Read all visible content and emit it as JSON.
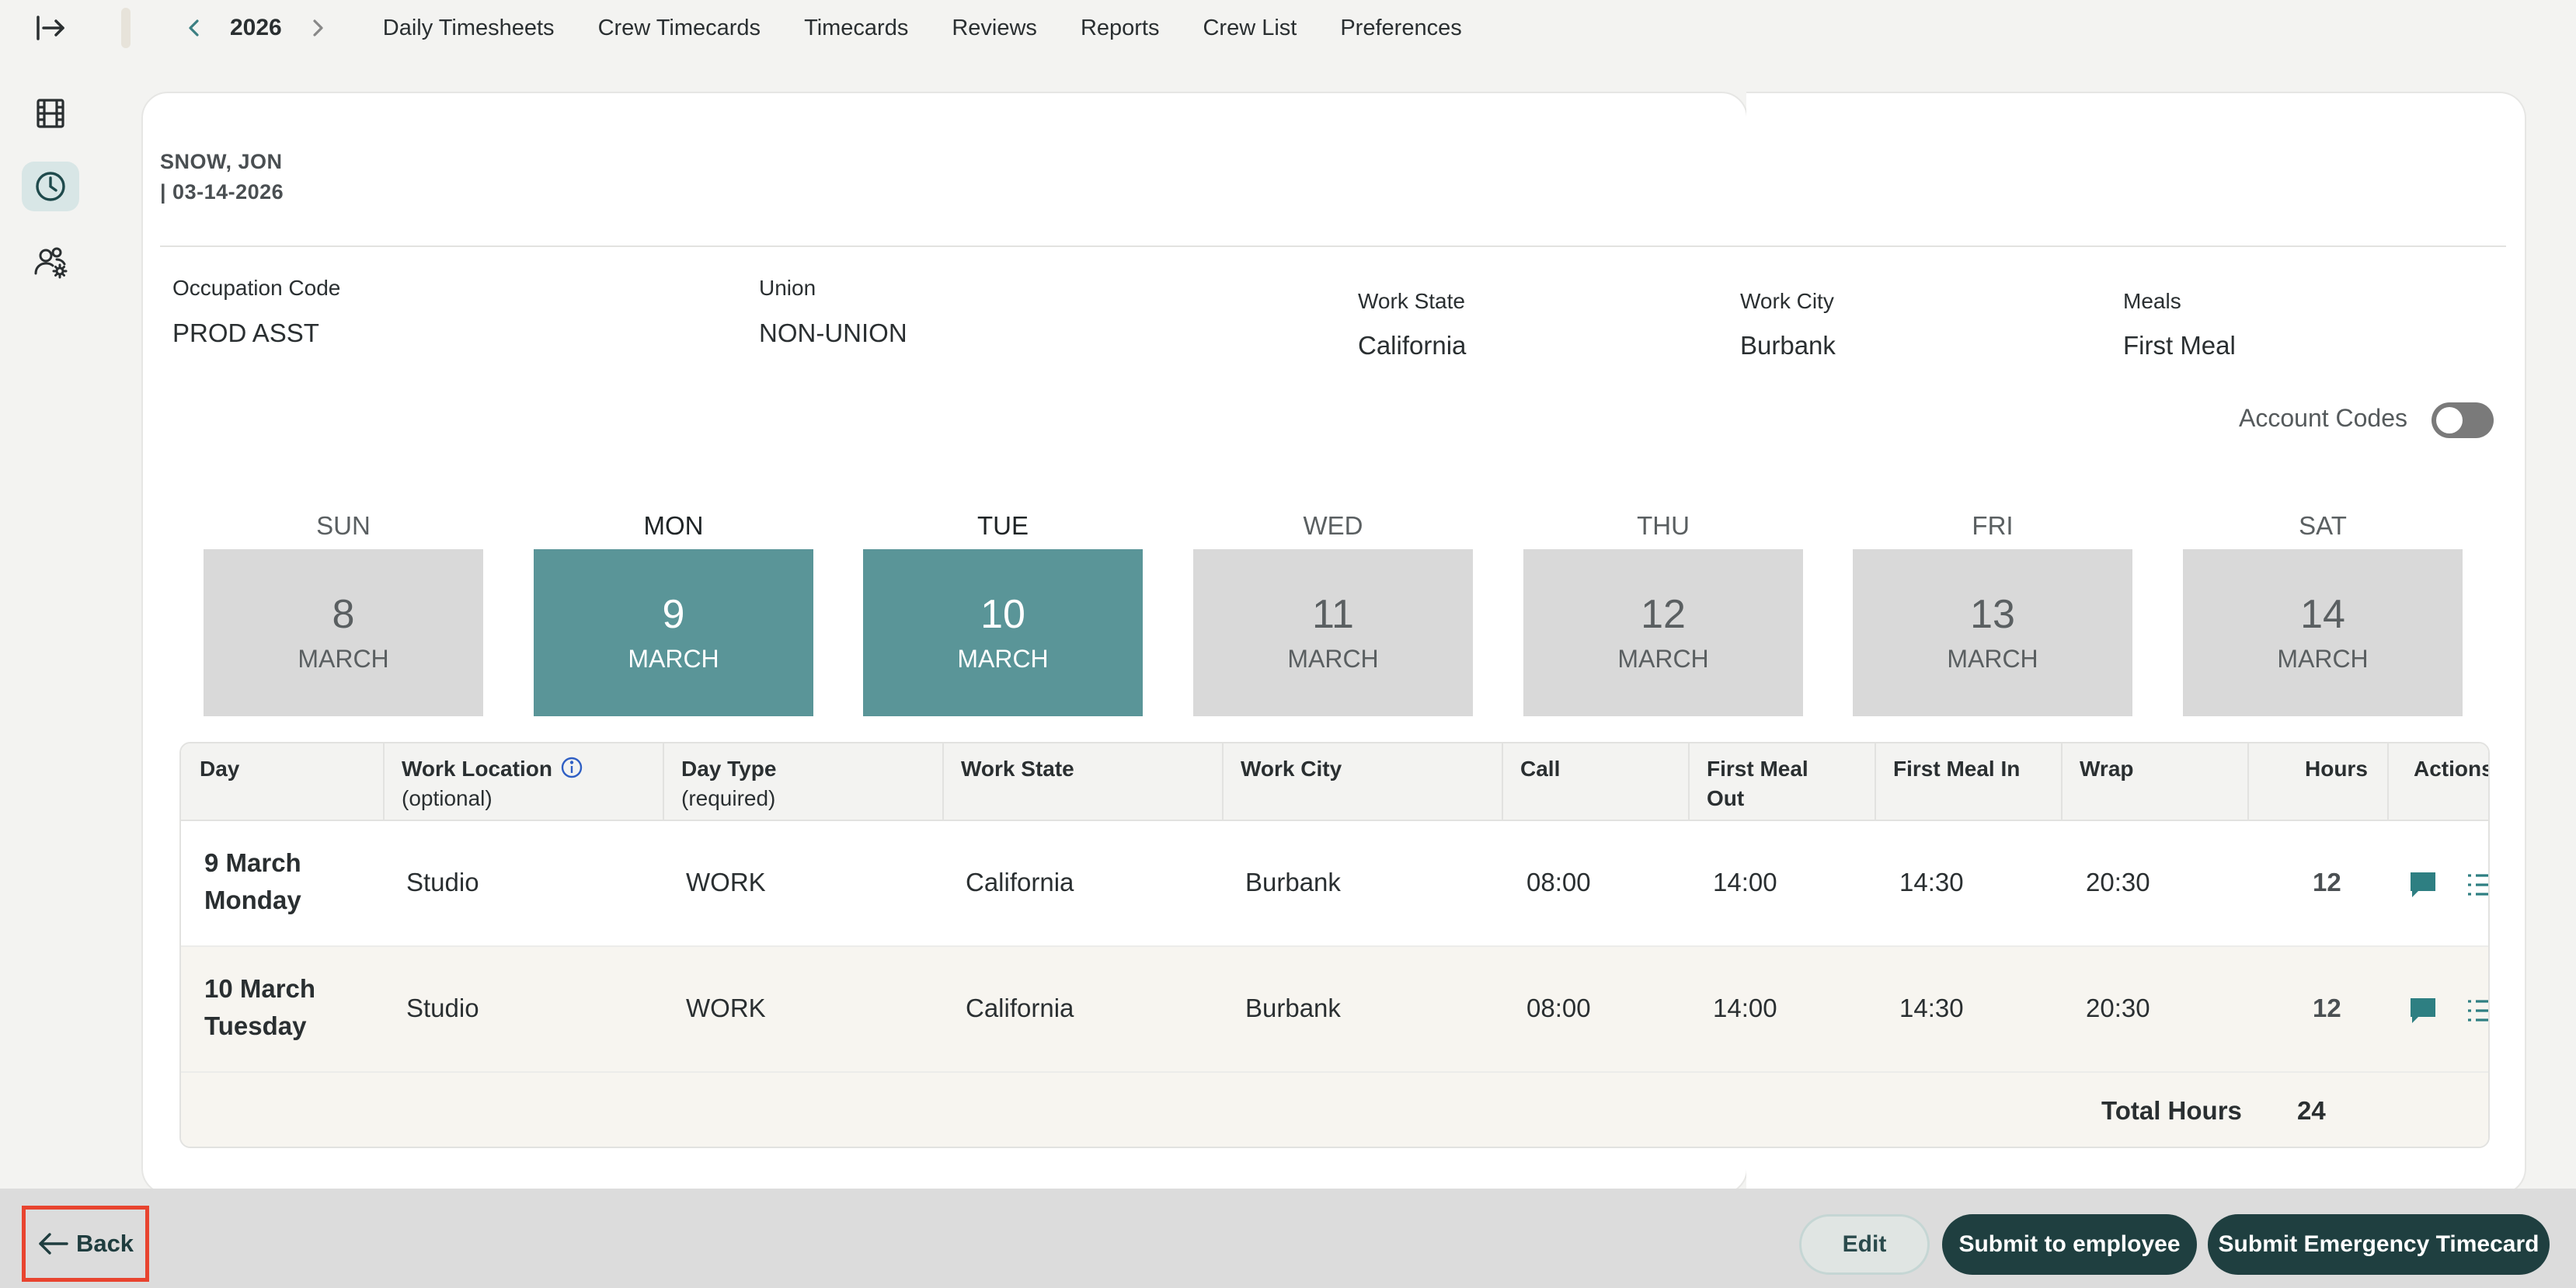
{
  "topnav": {
    "year": "2026",
    "links": [
      "Daily Timesheets",
      "Crew Timecards",
      "Timecards",
      "Reviews",
      "Reports",
      "Crew List",
      "Preferences"
    ]
  },
  "employee": {
    "name": "SNOW, JON",
    "date": "| 03-14-2026"
  },
  "fields": {
    "occupation_label": "Occupation Code",
    "occupation_value": "PROD ASST",
    "union_label": "Union",
    "union_value": "NON-UNION",
    "state_label": "Work State",
    "state_value": "California",
    "city_label": "Work City",
    "city_value": "Burbank",
    "meals_label": "Meals",
    "meals_value": "First Meal"
  },
  "account_codes": {
    "label": "Account Codes",
    "enabled": false
  },
  "week": [
    {
      "day": "SUN",
      "num": "8",
      "month": "MARCH",
      "selected": false
    },
    {
      "day": "MON",
      "num": "9",
      "month": "MARCH",
      "selected": true
    },
    {
      "day": "TUE",
      "num": "10",
      "month": "MARCH",
      "selected": true
    },
    {
      "day": "WED",
      "num": "11",
      "month": "MARCH",
      "selected": false
    },
    {
      "day": "THU",
      "num": "12",
      "month": "MARCH",
      "selected": false
    },
    {
      "day": "FRI",
      "num": "13",
      "month": "MARCH",
      "selected": false
    },
    {
      "day": "SAT",
      "num": "14",
      "month": "MARCH",
      "selected": false
    }
  ],
  "table": {
    "headers": {
      "day": "Day",
      "location": "Work Location",
      "location_sub": "(optional)",
      "daytype": "Day Type",
      "daytype_sub": "(required)",
      "state": "Work State",
      "city": "Work City",
      "call": "Call",
      "meal_out_1": "First Meal",
      "meal_out_2": "Out",
      "meal_in": "First Meal In",
      "wrap": "Wrap",
      "hours": "Hours",
      "actions": "Actions"
    },
    "rows": [
      {
        "date": "9 March",
        "weekday": "Monday",
        "location": "Studio",
        "daytype": "WORK",
        "state": "California",
        "city": "Burbank",
        "call": "08:00",
        "meal_out": "14:00",
        "meal_in": "14:30",
        "wrap": "20:30",
        "hours": "12"
      },
      {
        "date": "10 March",
        "weekday": "Tuesday",
        "location": "Studio",
        "daytype": "WORK",
        "state": "California",
        "city": "Burbank",
        "call": "08:00",
        "meal_out": "14:00",
        "meal_in": "14:30",
        "wrap": "20:30",
        "hours": "12"
      }
    ],
    "total_label": "Total Hours",
    "total_value": "24"
  },
  "footer": {
    "back": "Back",
    "edit": "Edit",
    "submit_employee": "Submit to employee",
    "submit_emergency": "Submit Emergency Timecard"
  },
  "colors": {
    "accent": "#5a9598",
    "dark_button": "#1f3f40",
    "highlight_border": "#e8442f"
  }
}
